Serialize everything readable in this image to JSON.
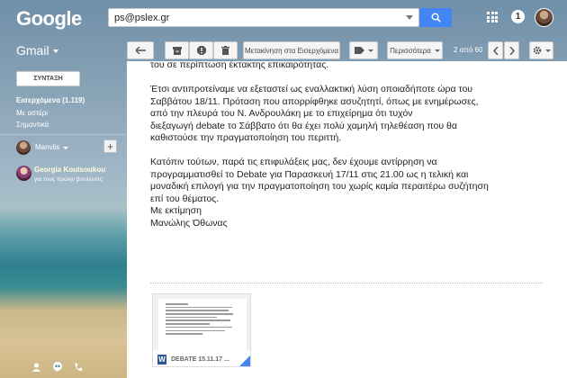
{
  "header": {
    "logo": "Google",
    "search_value": "ps@pslex.gr",
    "notifications": "1"
  },
  "toolbar": {
    "app_label": "Gmail",
    "move_to_inbox": "Μετακίνηση στα Εισερχόμενα",
    "more": "Περισσότερα",
    "pagination": "2 από 60"
  },
  "sidebar": {
    "compose": "ΣΥΝΤΑΞΗ",
    "items": [
      {
        "label": "Εισερχόμενα (1.119)"
      },
      {
        "label": "Με αστέρι"
      },
      {
        "label": "Σημαντικά"
      }
    ],
    "hangouts_user": "Manvlis",
    "contact_name": "Georgia Koutsoukou",
    "contact_status": "για τους πρώην βουλευτές"
  },
  "email": {
    "line_top": "του σε περίπτωση έκτακτης επικαιρότητας.",
    "para1": "Έτσι  αντιπροτείναμε να εξεταστεί ως εναλλακτική λύση οποιαδήποτε ώρα του\nΣαββάτου 18/11.  Πρόταση που απορρίφθηκε ασυζητητί, όπως με ενημέρωσες,\n από την πλευρά του Ν. Ανδρουλάκη με το επιχείρημα ότι  τυχόν\nδιεξαγωγή debate  το Σάββατο ότι θα έχει πολύ χαμηλή τηλεθέαση που θα\nκαθιστούσε την πραγματοποίηση του περιττή.",
    "para2": "Κατόπιν τούτων, παρά τις επιφυλάξεις μας, δεν έχουμε αντίρρηση να\nπρογραμματισθεί το Debate για  Παρασκευή 17/11 στις 21.00 ως  η τελική και\nμοναδική επιλογή για την πραγματοποίηση του χωρίς καμία περαιτέρω συζήτηση\nεπί του θέματος.\nΜε εκτίμηση\nΜανώλης Όθωνας",
    "attachment_name": "DEBATE 15.11.17 ...",
    "attachment_icon_letter": "W"
  },
  "colors": {
    "search_button": "#4285f4",
    "word_icon": "#2b5797"
  }
}
